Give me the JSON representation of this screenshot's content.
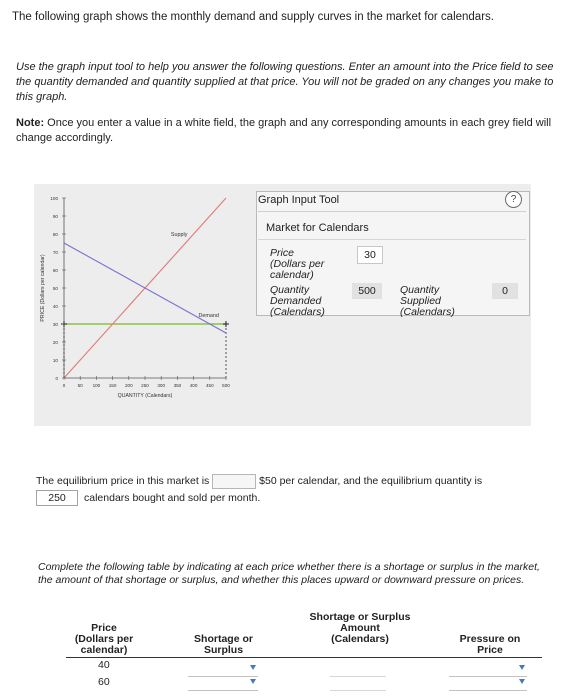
{
  "intro": "The following graph shows the monthly demand and supply curves in the market for calendars.",
  "instructions": "Use the graph input tool to help you answer the following questions. Enter an amount into the Price field to see the quantity demanded and quantity supplied at that price. You will not be graded on any changes you make to this graph.",
  "note": {
    "label": "Note:",
    "text": " Once you enter a value in a white field, the graph and any corresponding amounts in each grey field will change accordingly."
  },
  "chart_data": {
    "type": "line",
    "xlabel": "QUANTITY (Calendars)",
    "ylabel": "PRICE (Dollars per calendar)",
    "xlim": [
      0,
      500
    ],
    "ylim": [
      0,
      100
    ],
    "x_ticks": [
      "0",
      "50",
      "100",
      "150",
      "200",
      "250",
      "300",
      "350",
      "400",
      "450",
      "500"
    ],
    "y_ticks": [
      "0",
      "10",
      "20",
      "30",
      "40",
      "50",
      "60",
      "70",
      "80",
      "90",
      "100"
    ],
    "series": [
      {
        "name": "Supply",
        "x": [
          0,
          500
        ],
        "y": [
          0,
          100
        ],
        "color": "#e07a7a"
      },
      {
        "name": "Demand",
        "x": [
          0,
          500
        ],
        "y": [
          75,
          25
        ],
        "color": "#7a6fcf"
      }
    ],
    "price_line": {
      "y": 30,
      "color": "#8fc04a"
    },
    "markers": [
      {
        "x": 0,
        "y": 30
      },
      {
        "x": 500,
        "y": 30
      }
    ],
    "demand_label_anchor": [
      415,
      34
    ]
  },
  "tool": {
    "title": "Graph Input Tool",
    "market": "Market for Calendars",
    "price_label": [
      "Price",
      "(Dollars per",
      "calendar)"
    ],
    "price_value": "30",
    "qd_label": [
      "Quantity",
      "Demanded",
      "(Calendars)"
    ],
    "qd_value": "500",
    "qs_label": [
      "Quantity",
      "Supplied",
      "(Calendars)"
    ],
    "qs_value": "0",
    "help": "?"
  },
  "equilibrium": {
    "text1": "The equilibrium price in this market is",
    "text2": "$50 per calendar, and the equilibrium quantity is",
    "qty_value": "250",
    "text3": "calendars bought and sold per month."
  },
  "complete_text": "Complete the following table by indicating at each price whether there is a shortage or surplus in the market, the amount of that shortage or surplus, and whether this places upward or downward pressure on prices.",
  "table": {
    "col_price": [
      "Price",
      "(Dollars per",
      "calendar)"
    ],
    "col_shortage": [
      "Shortage or",
      "Surplus"
    ],
    "col_amount": [
      "Shortage or Surplus",
      "Amount",
      "(Calendars)"
    ],
    "col_pressure": [
      "Pressure on",
      "Price"
    ],
    "rows": [
      {
        "price": "40"
      },
      {
        "price": "60"
      }
    ]
  }
}
